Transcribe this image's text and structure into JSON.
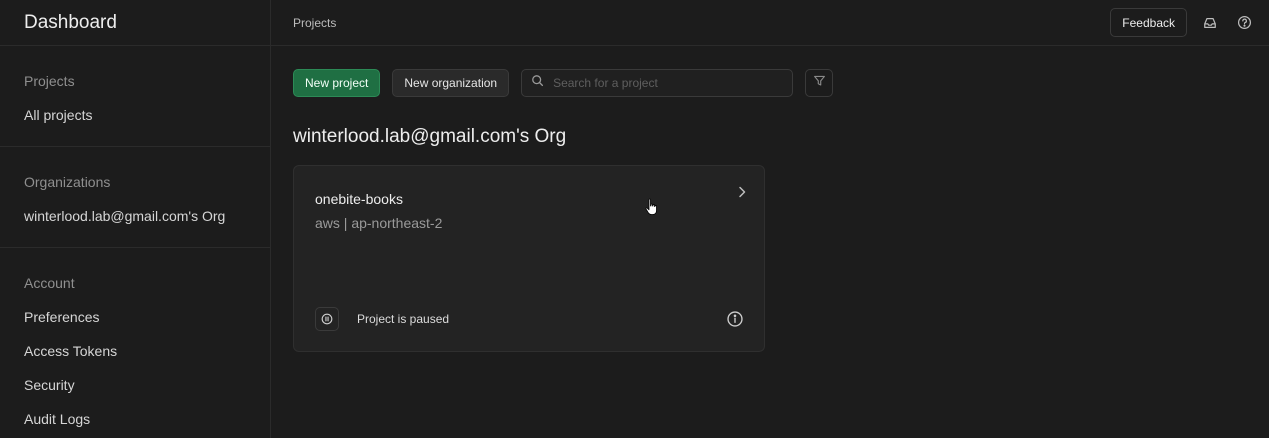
{
  "app": {
    "title": "Dashboard"
  },
  "sidebar": {
    "sections": [
      {
        "heading": "Projects",
        "items": [
          {
            "label": "All projects"
          }
        ]
      },
      {
        "heading": "Organizations",
        "items": [
          {
            "label": "winterlood.lab@gmail.com's Org"
          }
        ]
      },
      {
        "heading": "Account",
        "items": [
          {
            "label": "Preferences"
          },
          {
            "label": "Access Tokens"
          },
          {
            "label": "Security"
          },
          {
            "label": "Audit Logs"
          }
        ]
      }
    ]
  },
  "header": {
    "breadcrumb": "Projects",
    "feedback_label": "Feedback",
    "icons": [
      "inbox-icon",
      "help-icon"
    ]
  },
  "toolbar": {
    "new_project_label": "New project",
    "new_org_label": "New organization",
    "search_placeholder": "Search for a project",
    "search_value": ""
  },
  "main": {
    "org_title": "winterlood.lab@gmail.com's Org",
    "projects": [
      {
        "name": "onebite-books",
        "region": "aws | ap-northeast-2",
        "status": "Project is paused"
      }
    ]
  },
  "colors": {
    "background": "#1c1c1c",
    "card": "#232323",
    "border": "#2b2b2b",
    "primary": "#1f6f43"
  }
}
